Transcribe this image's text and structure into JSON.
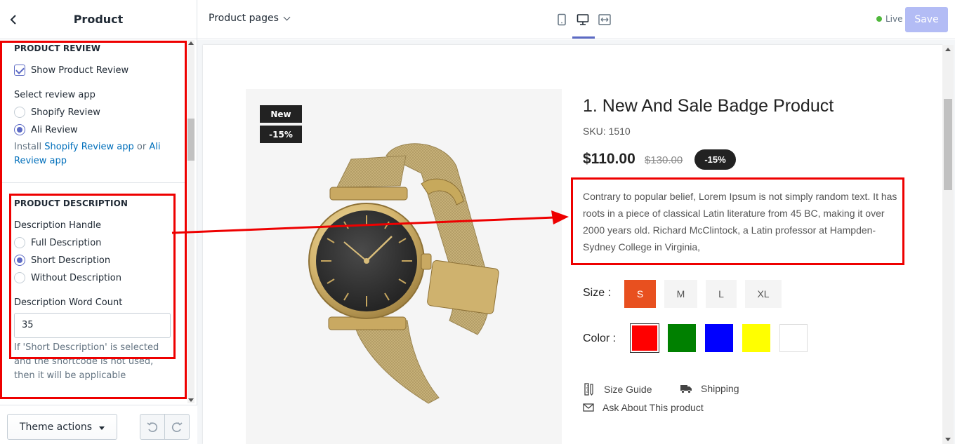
{
  "sidebar": {
    "title": "Product",
    "review": {
      "section_title": "PRODUCT REVIEW",
      "show_label": "Show Product Review",
      "select_label": "Select review app",
      "options": [
        "Shopify Review",
        "Ali Review"
      ],
      "selected": "Ali Review",
      "help_prefix": "Install ",
      "help_link1": "Shopify Review app",
      "help_mid": " or ",
      "help_link2": "Ali Review app"
    },
    "description": {
      "section_title": "PRODUCT DESCRIPTION",
      "handle_label": "Description Handle",
      "options": [
        "Full Description",
        "Short Description",
        "Without Description"
      ],
      "selected": "Short Description",
      "word_count_label": "Description Word Count",
      "word_count_value": "35",
      "help": "If 'Short Description' is selected and the shortcode is not used, then it will be applicable"
    },
    "footer": {
      "theme_actions": "Theme actions"
    }
  },
  "topbar": {
    "page_selector": "Product pages",
    "status": "Live",
    "save": "Save"
  },
  "product": {
    "badge_new": "New",
    "badge_off": "-15%",
    "title": "1. New And Sale Badge Product",
    "sku": "SKU: 1510",
    "price": "$110.00",
    "old_price": "$130.00",
    "discount": "-15%",
    "description": "Contrary to popular belief, Lorem Ipsum is not simply random text. It has roots in a piece of classical Latin literature from 45 BC, making it over 2000 years old. Richard McClintock, a Latin professor at Hampden-Sydney College in Virginia,",
    "size_label": "Size :",
    "sizes": [
      "S",
      "M",
      "L",
      "XL"
    ],
    "selected_size": "S",
    "color_label": "Color :",
    "colors": [
      "#ff0000",
      "#008000",
      "#0000ff",
      "#ffff00",
      "#ffffff"
    ],
    "size_guide": "Size Guide",
    "shipping": "Shipping",
    "ask": "Ask About This product"
  },
  "colors": {
    "accent": "#5c6ac4",
    "annotation": "#ee0000",
    "size_active": "#e8501f"
  }
}
